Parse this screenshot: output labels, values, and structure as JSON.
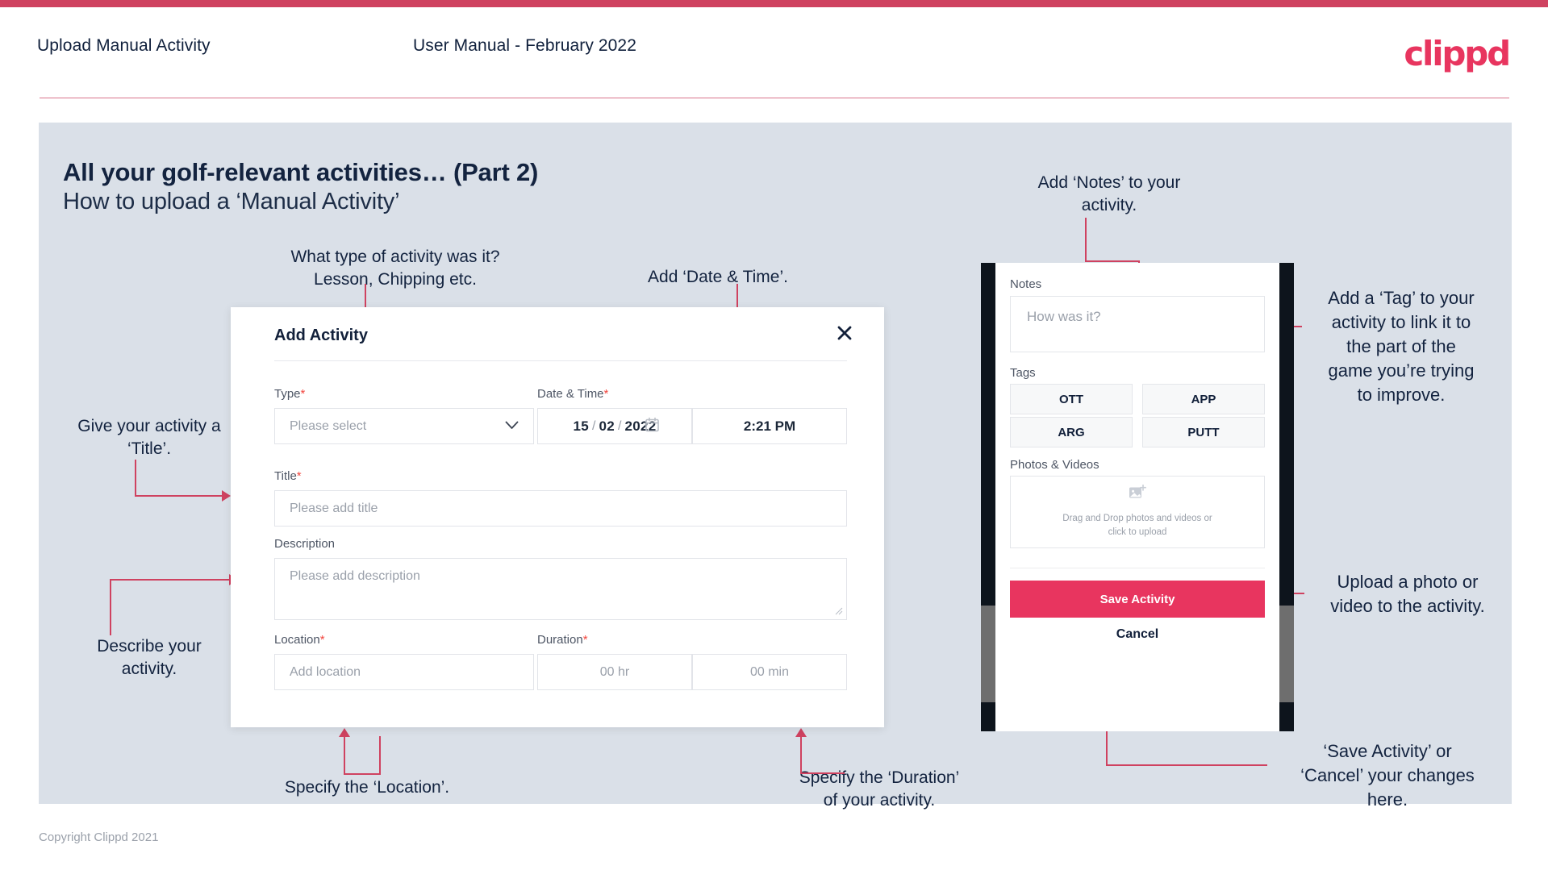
{
  "header": {
    "title": "Upload Manual Activity",
    "subtitle": "User Manual - February 2022",
    "logo": "clippd"
  },
  "slide": {
    "title": "All your golf-relevant activities… (Part 2)",
    "subtitle": "How to upload a ‘Manual Activity’"
  },
  "annotations": {
    "type": "What type of activity was it?\nLesson, Chipping etc.",
    "datetime": "Add ‘Date & Time’.",
    "title": "Give your activity a\n‘Title’.",
    "description": "Describe your\nactivity.",
    "location": "Specify the ‘Location’.",
    "duration": "Specify the ‘Duration’\nof your activity.",
    "notes": "Add ‘Notes’ to your\nactivity.",
    "tags": "Add a ‘Tag’ to your\nactivity to link it to\nthe part of the\ngame you’re trying\nto improve.",
    "upload": "Upload a photo or\nvideo to the activity.",
    "save": "‘Save Activity’ or\n‘Cancel’ your changes\nhere."
  },
  "dialog": {
    "title": "Add Activity",
    "close_icon": "close-icon",
    "fields": {
      "type": {
        "label": "Type",
        "required": "*",
        "placeholder": "Please select",
        "chevron_icon": "chevron-down-icon"
      },
      "datetime": {
        "label": "Date & Time",
        "required": "*",
        "day": "15",
        "month": "02",
        "year": "2022",
        "sep1": "/",
        "sep2": "/",
        "calendar_icon": "calendar-icon",
        "time": "2:21 PM"
      },
      "title": {
        "label": "Title",
        "required": "*",
        "placeholder": "Please add title"
      },
      "description": {
        "label": "Description",
        "required": "",
        "placeholder": "Please add description"
      },
      "location": {
        "label": "Location",
        "required": "*",
        "placeholder": "Add location"
      },
      "duration": {
        "label": "Duration",
        "required": "*",
        "hours": "00 hr",
        "minutes": "00 min"
      }
    }
  },
  "phone": {
    "notes": {
      "label": "Notes",
      "placeholder": "How was it?"
    },
    "tags": {
      "label": "Tags",
      "items": [
        "OTT",
        "APP",
        "ARG",
        "PUTT"
      ]
    },
    "photos": {
      "label": "Photos & Videos",
      "icon": "add-image-icon",
      "dropzone_text": "Drag and Drop photos and videos or\nclick to upload"
    },
    "save_label": "Save Activity",
    "cancel_label": "Cancel"
  },
  "footer": {
    "copyright": "Copyright Clippd 2021"
  },
  "colors": {
    "accent": "#e8355f",
    "rule": "#cf4260",
    "slide_bg": "#dae0e8",
    "text_dark": "#13233f"
  }
}
